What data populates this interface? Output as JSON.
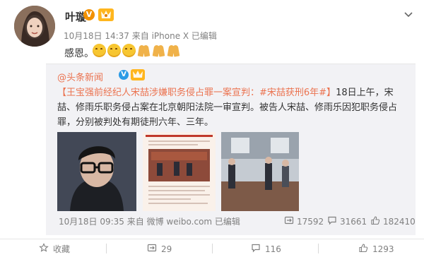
{
  "post": {
    "author": "叶璇",
    "verified_badge": "V",
    "meta": "10月18日 14:37 来自 iPhone X  已编辑",
    "text": "感恩。",
    "emojis": [
      "smile-emoji",
      "smile-emoji",
      "smile-emoji",
      "pray-emoji",
      "pray-emoji",
      "pray-emoji"
    ],
    "more_icon": "chevron-down-icon"
  },
  "repost": {
    "author": "@头条新闻",
    "verified_badge": "V",
    "text_link": "【王宝强前经纪人宋喆涉嫌职务侵占罪一案宣判：#宋喆获刑6年#】",
    "text_body": "18日上午，宋喆、修雨乐职务侵占案在北京朝阳法院一审宣判。被告人宋喆、修雨乐因犯职务侵占罪，分别被判处有期徒刑六年、三年。",
    "meta": "10月18日 09:35 来自 微博 weibo.com  已编辑",
    "stats": {
      "reposts": "17592",
      "comments": "31661",
      "likes": "182410"
    }
  },
  "actions": {
    "favorite": "收藏",
    "repost_count": "29",
    "comment_count": "116",
    "like_count": "1293"
  },
  "colors": {
    "accent": "#eb7350",
    "meta_gray": "#808080",
    "repost_bg": "#f2f2f5"
  }
}
